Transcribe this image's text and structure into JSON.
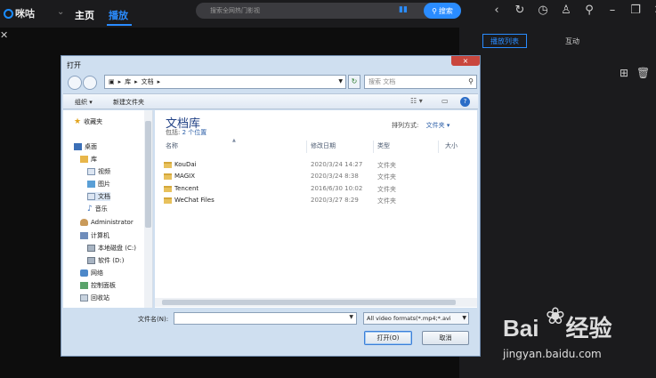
{
  "app": {
    "logo_text": "咪咕",
    "nav_home": "主页",
    "nav_play": "播放",
    "search_placeholder": "搜索全网热门影视",
    "search_button": "搜索",
    "accent_color": "#2a8cff"
  },
  "right_panel": {
    "tab_playlist": "播放列表",
    "tab_interact": "互动"
  },
  "dialog": {
    "title": "打开",
    "close_label": "×",
    "address": [
      "库",
      "文档"
    ],
    "search_placeholder": "搜索 文档",
    "organize": "组织 ▾",
    "new_folder": "新建文件夹",
    "navigation": {
      "favorites": "收藏夹",
      "desktop": "桌面",
      "libraries": "库",
      "videos": "视频",
      "pictures": "图片",
      "documents": "文档",
      "music": "音乐",
      "administrator": "Administrator",
      "computer": "计算机",
      "local_disk_c": "本地磁盘 (C:)",
      "software_d": "软件 (D:)",
      "network": "网络",
      "control_panel": "控制面板",
      "recycle_bin": "回收站"
    },
    "library_title": "文档库",
    "library_includes": "包括:",
    "library_locations": "2 个位置",
    "arrange_label": "排列方式:",
    "arrange_value": "文件夹 ▾",
    "columns": {
      "name": "名称",
      "modified": "修改日期",
      "type": "类型",
      "size": "大小"
    },
    "files": [
      {
        "name": "KouDai",
        "date": "2020/3/24 14:27",
        "type": "文件夹"
      },
      {
        "name": "MAGIX",
        "date": "2020/3/24 8:38",
        "type": "文件夹"
      },
      {
        "name": "Tencent",
        "date": "2016/6/30 10:02",
        "type": "文件夹"
      },
      {
        "name": "WeChat Files",
        "date": "2020/3/27 8:29",
        "type": "文件夹"
      }
    ],
    "filename_label": "文件名(N):",
    "filename_value": "",
    "filetype_value": "All video formats(*.mp4;*.avi",
    "open_button": "打开(O)",
    "cancel_button": "取消"
  },
  "watermark": {
    "brand": "Bai",
    "brand_suffix": "经验",
    "url": "jingyan.baidu.com"
  }
}
